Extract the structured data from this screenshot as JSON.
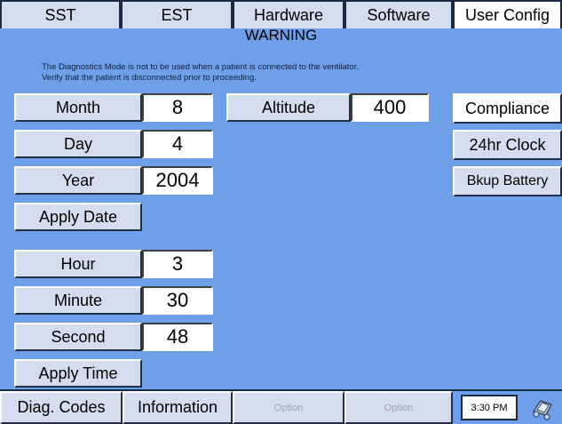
{
  "tabs": [
    "SST",
    "EST",
    "Hardware",
    "Software",
    "User Config"
  ],
  "warning": {
    "title": "WARNING",
    "line1": "The Diagnostics Mode is not to be used when a patient is connected to the ventilator.",
    "line2": "Verify that the patient is disconnected prior to proceeding."
  },
  "date": {
    "month_label": "Month",
    "month_value": "8",
    "day_label": "Day",
    "day_value": "4",
    "year_label": "Year",
    "year_value": "2004",
    "apply_label": "Apply Date"
  },
  "time": {
    "hour_label": "Hour",
    "hour_value": "3",
    "minute_label": "Minute",
    "minute_value": "30",
    "second_label": "Second",
    "second_value": "48",
    "apply_label": "Apply Time"
  },
  "altitude": {
    "label": "Altitude",
    "value": "400"
  },
  "right_buttons": [
    "Compliance",
    "24hr Clock",
    "Bkup Battery"
  ],
  "bottom": {
    "diag_codes": "Diag. Codes",
    "information": "Information",
    "option1": "Option",
    "option2": "Option",
    "clock": "3:30 PM"
  },
  "colors": {
    "background": "#6f9fe8",
    "button": "#d5dced",
    "active_tab": "#ffffff"
  }
}
